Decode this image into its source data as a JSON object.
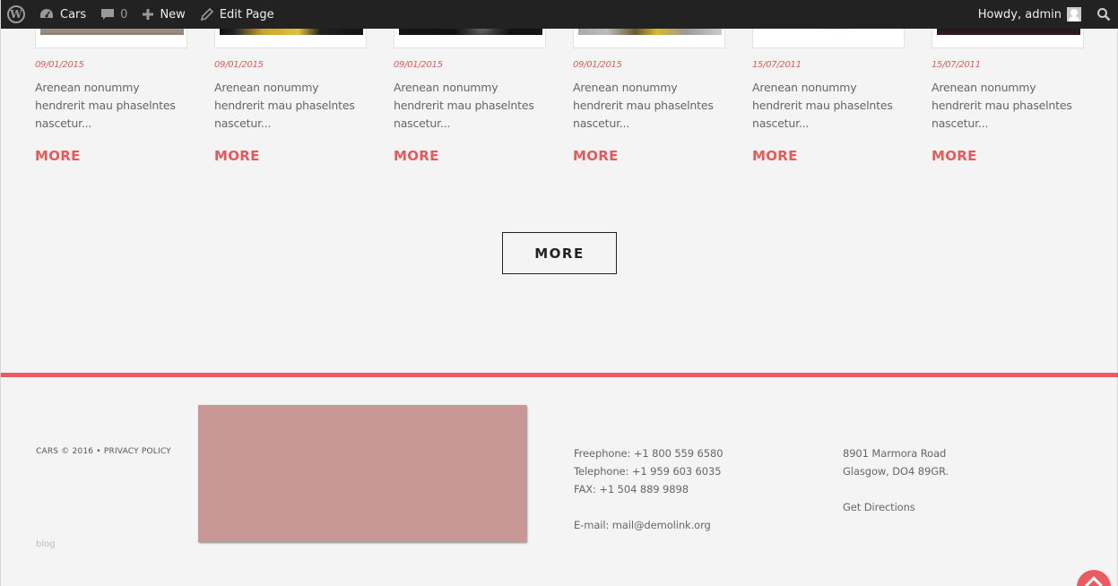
{
  "admin_bar": {
    "site_name": "Cars",
    "comments_count": "0",
    "new_label": "New",
    "edit_label": "Edit Page",
    "greeting": "Howdy, admin"
  },
  "posts": [
    {
      "date": "09/01/2015",
      "excerpt": "Arenean nonummy hendrerit mau phaselntes nascetur...",
      "more": "MORE"
    },
    {
      "date": "09/01/2015",
      "excerpt": "Arenean nonummy hendrerit mau phaselntes nascetur...",
      "more": "MORE"
    },
    {
      "date": "09/01/2015",
      "excerpt": "Arenean nonummy hendrerit mau phaselntes nascetur...",
      "more": "MORE"
    },
    {
      "date": "09/01/2015",
      "excerpt": "Arenean nonummy hendrerit mau phaselntes nascetur...",
      "more": "MORE"
    },
    {
      "date": "15/07/2011",
      "excerpt": "Arenean nonummy hendrerit mau phaselntes nascetur...",
      "more": "MORE"
    },
    {
      "date": "15/07/2011",
      "excerpt": "Arenean nonummy hendrerit mau phaselntes nascetur...",
      "more": "MORE"
    }
  ],
  "load_more_label": "MORE",
  "footer": {
    "copyright": "CARS © 2016 • PRIVACY POLICY",
    "blog_link": "blog",
    "freephone": "Freephone: +1 800 559 6580",
    "telephone": "Telephone: +1 959 603 6035",
    "fax": "FAX: +1 504 889 9898",
    "email": "E-mail: mail@demolink.org",
    "address_line1": "8901 Marmora Road",
    "address_line2": "Glasgow, DO4 89GR.",
    "directions": "Get Directions"
  },
  "colors": {
    "accent": "#ea5a5e",
    "map_placeholder": "#c99796",
    "admin_bar": "#222222"
  }
}
